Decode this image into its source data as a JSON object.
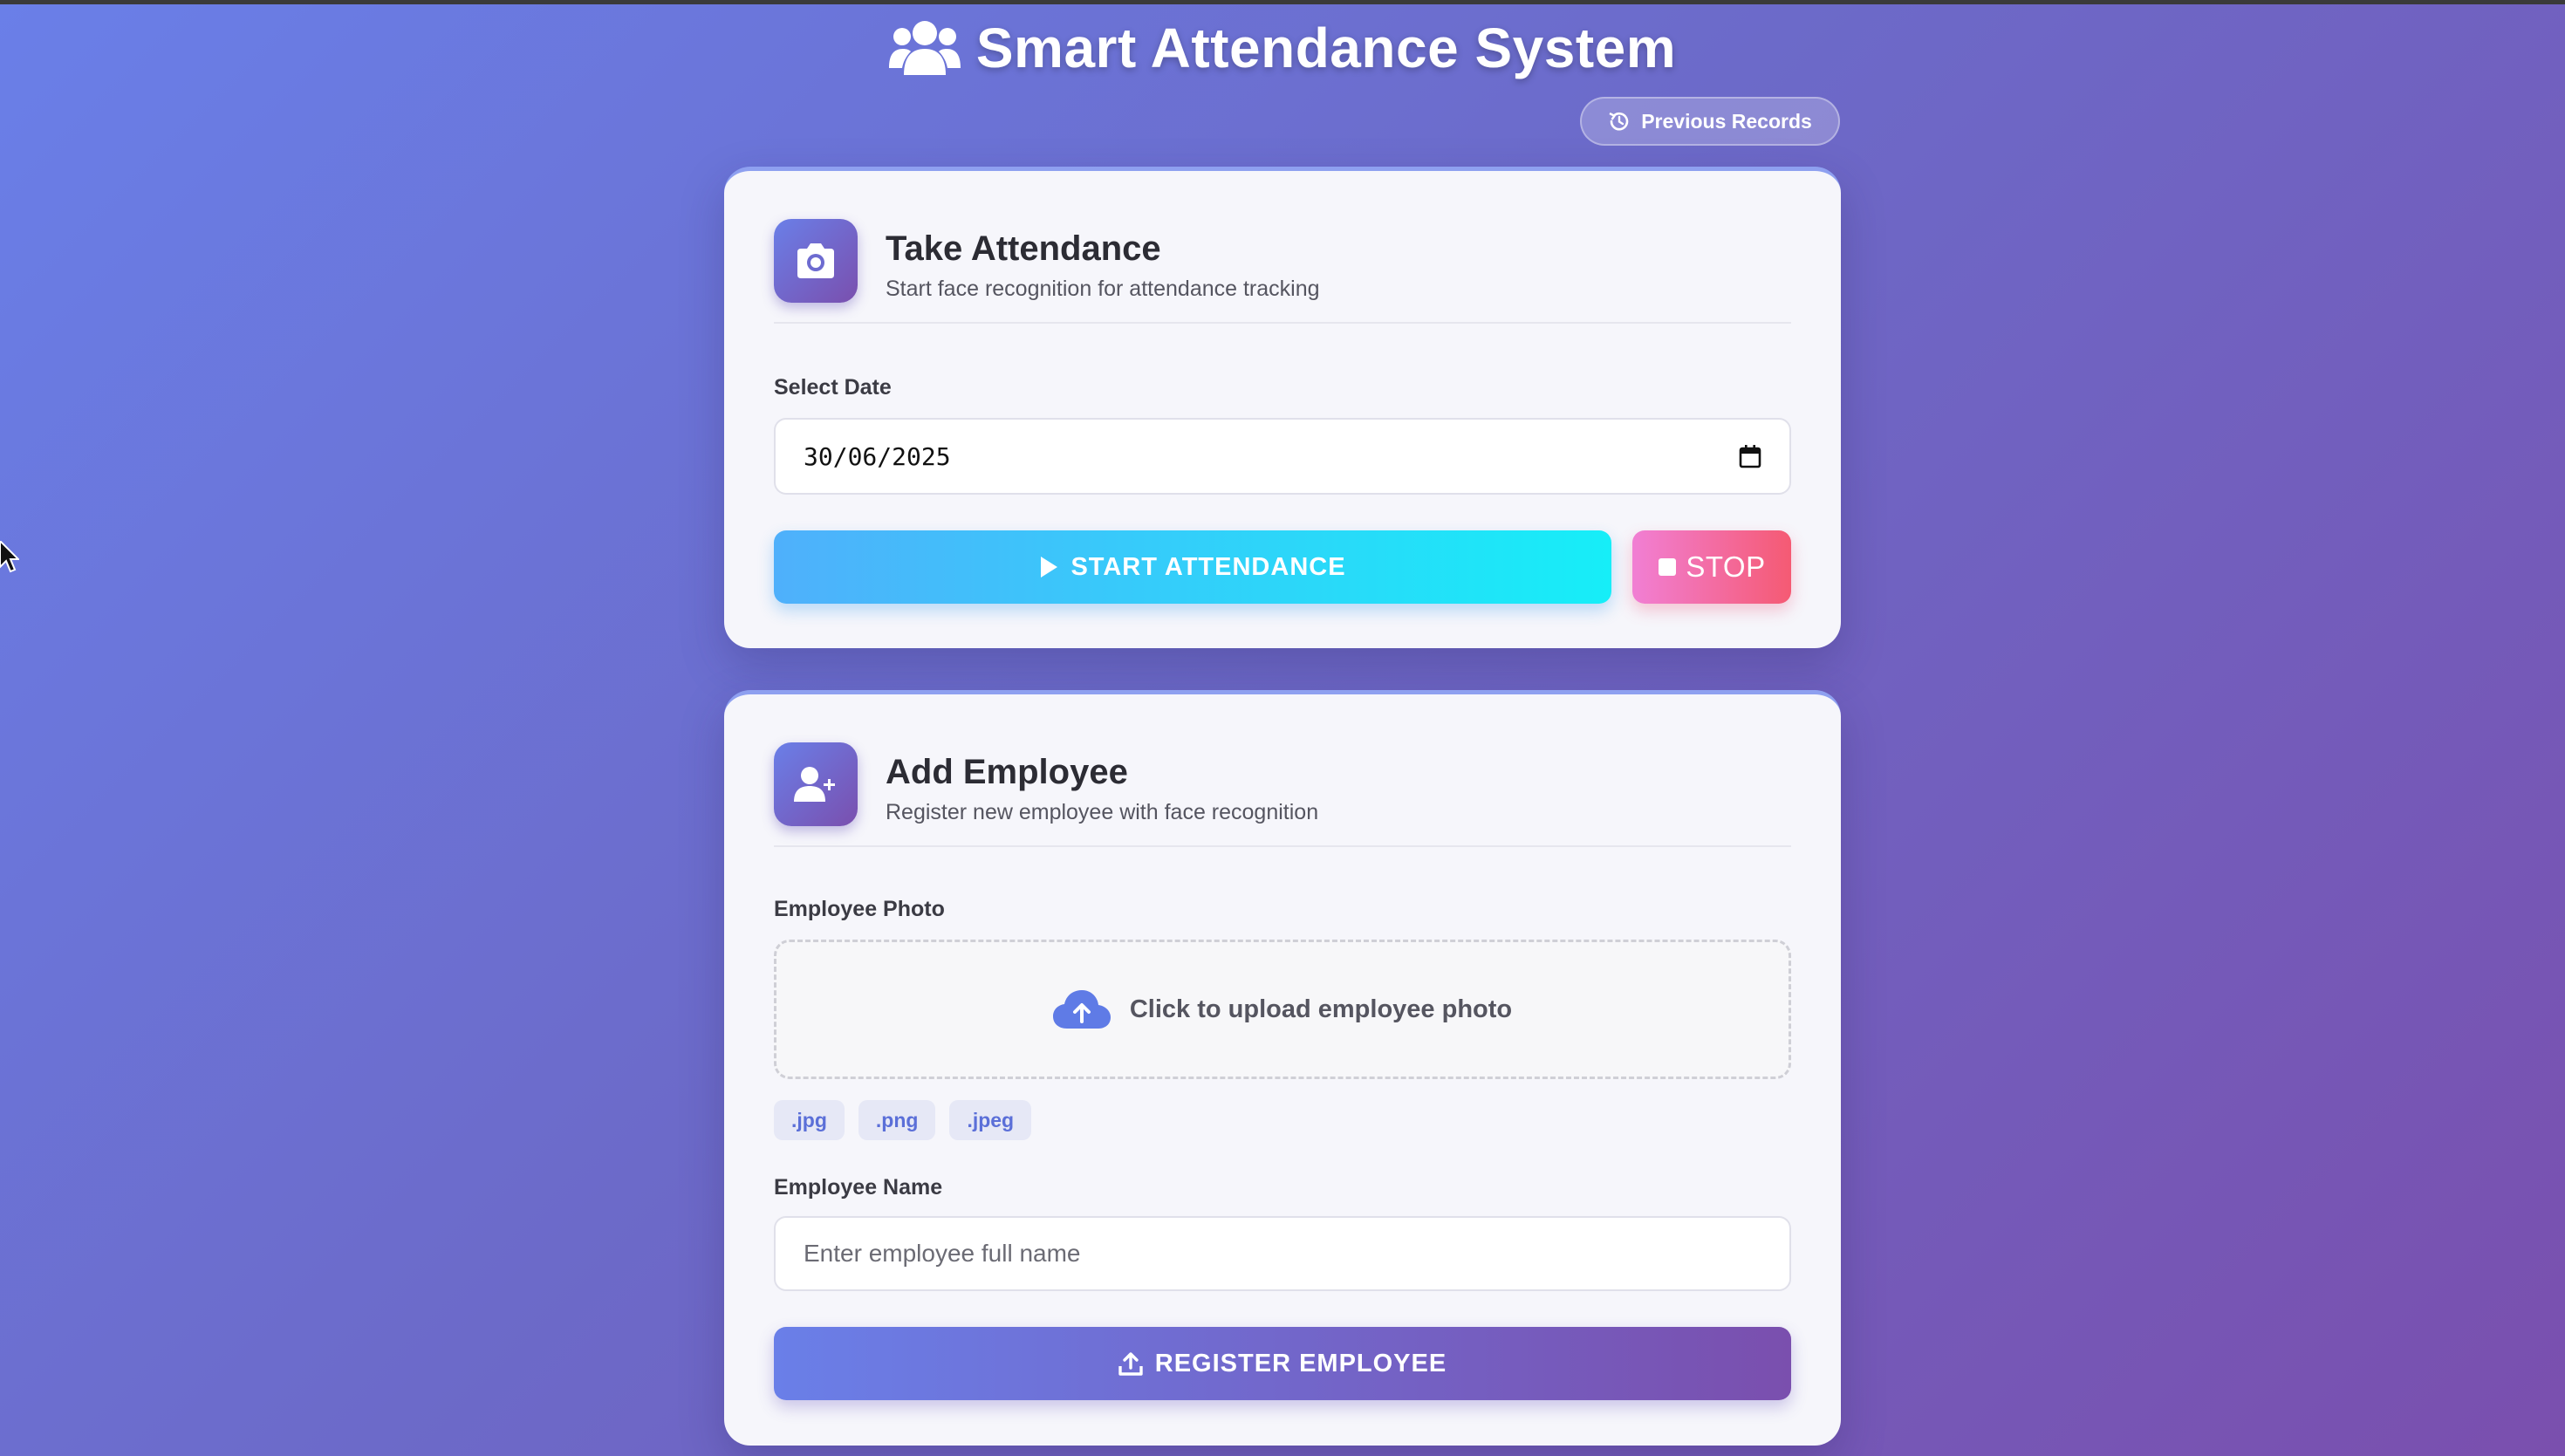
{
  "header": {
    "title": "Smart Attendance System",
    "icon": "users-icon"
  },
  "previous_records": {
    "label": "Previous Records",
    "icon": "history-icon"
  },
  "attendance": {
    "title": "Take Attendance",
    "subtitle": "Start face recognition for attendance tracking",
    "icon": "camera-icon",
    "date_label": "Select Date",
    "date_value": "30/06/2025",
    "start_label": "START ATTENDANCE",
    "stop_label": "STOP"
  },
  "employee": {
    "title": "Add Employee",
    "subtitle": "Register new employee with face recognition",
    "icon": "user-plus-icon",
    "photo_label": "Employee Photo",
    "upload_text": "Click to upload employee photo",
    "file_types": [
      ".jpg",
      ".png",
      ".jpeg"
    ],
    "name_label": "Employee Name",
    "name_placeholder": "Enter employee full name",
    "register_label": "REGISTER EMPLOYEE"
  },
  "colors": {
    "accent_start": "#6a7fe8",
    "accent_end": "#7a4fae",
    "start_button": "#16eef8",
    "stop_button": "#f55a73"
  }
}
